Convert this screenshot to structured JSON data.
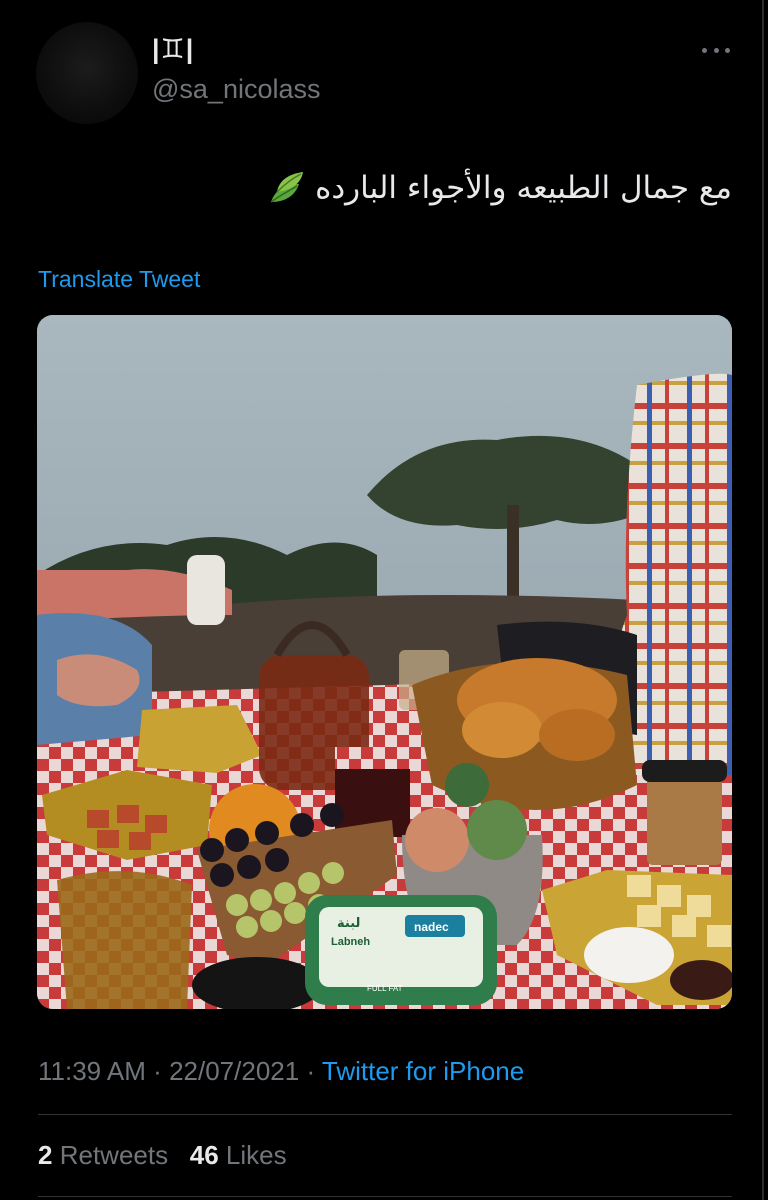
{
  "user": {
    "display_name": "|♊|",
    "handle": "@sa_nicolass"
  },
  "tweet": {
    "text": "مع جمال الطبيعه والأجواء البارده",
    "emoji_icon": "leaves-icon",
    "translate_label": "Translate Tweet",
    "time": "11:39 AM",
    "date": "22/07/2021",
    "separator": "·",
    "source": "Twitter for iPhone"
  },
  "media_labels": {
    "labneh_arabic": "لبنة",
    "labneh_latin": "Labneh",
    "brand": "nadec",
    "full_fat": "FULL FAT"
  },
  "stats": {
    "retweets_count": "2",
    "retweets_label": "Retweets",
    "likes_count": "46",
    "likes_label": "Likes"
  },
  "colors": {
    "background": "#000000",
    "link": "#1d9bf0",
    "muted": "#71767b",
    "text": "#e7e9ea"
  },
  "icons": [
    "more-icon",
    "leaves-icon"
  ]
}
